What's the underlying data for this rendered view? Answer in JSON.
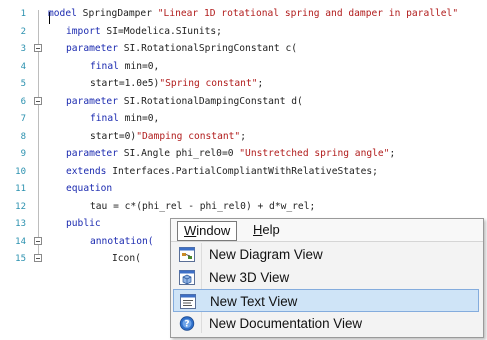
{
  "editor": {
    "lines": [
      {
        "no": "1",
        "fold": false,
        "indent": 0,
        "parts": [
          {
            "t": "model",
            "c": "kw"
          },
          {
            "t": " SpringDamper ",
            "c": ""
          },
          {
            "t": "\"Linear 1D rotational spring and damper in parallel\"",
            "c": "str"
          }
        ]
      },
      {
        "no": "2",
        "fold": false,
        "indent": 1,
        "parts": [
          {
            "t": "import",
            "c": "kw"
          },
          {
            "t": " SI=Modelica.SIunits;",
            "c": ""
          }
        ]
      },
      {
        "no": "3",
        "fold": true,
        "indent": 1,
        "parts": [
          {
            "t": "parameter",
            "c": "kw"
          },
          {
            "t": " SI.RotationalSpringConstant c(",
            "c": ""
          }
        ]
      },
      {
        "no": "4",
        "fold": false,
        "indent": 2,
        "parts": [
          {
            "t": "final",
            "c": "kw"
          },
          {
            "t": " min=0,",
            "c": ""
          }
        ]
      },
      {
        "no": "5",
        "fold": false,
        "indent": 2,
        "parts": [
          {
            "t": "start=1.0e5)",
            "c": ""
          },
          {
            "t": "\"Spring constant\"",
            "c": "str"
          },
          {
            "t": ";",
            "c": ""
          }
        ]
      },
      {
        "no": "6",
        "fold": true,
        "indent": 1,
        "parts": [
          {
            "t": "parameter",
            "c": "kw"
          },
          {
            "t": " SI.RotationalDampingConstant d(",
            "c": ""
          }
        ]
      },
      {
        "no": "7",
        "fold": false,
        "indent": 2,
        "parts": [
          {
            "t": "final",
            "c": "kw"
          },
          {
            "t": " min=0,",
            "c": ""
          }
        ]
      },
      {
        "no": "8",
        "fold": false,
        "indent": 2,
        "parts": [
          {
            "t": "start=0)",
            "c": ""
          },
          {
            "t": "\"Damping constant\"",
            "c": "str"
          },
          {
            "t": ";",
            "c": ""
          }
        ]
      },
      {
        "no": "9",
        "fold": false,
        "indent": 1,
        "parts": [
          {
            "t": "parameter",
            "c": "kw"
          },
          {
            "t": " SI.Angle phi_rel0=0 ",
            "c": ""
          },
          {
            "t": "\"Unstretched spring angle\"",
            "c": "str"
          },
          {
            "t": ";",
            "c": ""
          }
        ]
      },
      {
        "no": "10",
        "fold": false,
        "indent": 1,
        "parts": [
          {
            "t": "extends",
            "c": "kw"
          },
          {
            "t": " Interfaces.PartialCompliantWithRelativeStates;",
            "c": ""
          }
        ]
      },
      {
        "no": "11",
        "fold": false,
        "indent": 1,
        "parts": [
          {
            "t": "equation",
            "c": "kw"
          }
        ]
      },
      {
        "no": "12",
        "fold": false,
        "indent": 2,
        "parts": [
          {
            "t": "tau = c*(phi_rel - phi_rel0) + d*w_rel;",
            "c": ""
          }
        ]
      },
      {
        "no": "13",
        "fold": false,
        "indent": 1,
        "parts": [
          {
            "t": "public",
            "c": "kw"
          }
        ]
      },
      {
        "no": "14",
        "fold": true,
        "indent": 2,
        "parts": [
          {
            "t": "annotation(",
            "c": "kw"
          }
        ]
      },
      {
        "no": "15",
        "fold": true,
        "indent": 3,
        "parts": [
          {
            "t": "Icon(",
            "c": ""
          }
        ]
      }
    ]
  },
  "menu": {
    "window_label_u": "W",
    "window_label_rest": "indow",
    "help_label_u": "H",
    "help_label_rest": "elp",
    "items": [
      {
        "label": "New Diagram View",
        "icon": "diagram-view-icon"
      },
      {
        "label": "New 3D View",
        "icon": "3d-view-icon"
      },
      {
        "label": "New Text View",
        "icon": "text-view-icon",
        "highlighted": true
      },
      {
        "label": "New Documentation View",
        "icon": "documentation-view-icon"
      }
    ]
  },
  "colors": {
    "keyword": "#1c2bb0",
    "string": "#b11d1d",
    "line_number": "#2b91af",
    "highlight": "#cfe4f7",
    "highlight_border": "#84acdd"
  }
}
